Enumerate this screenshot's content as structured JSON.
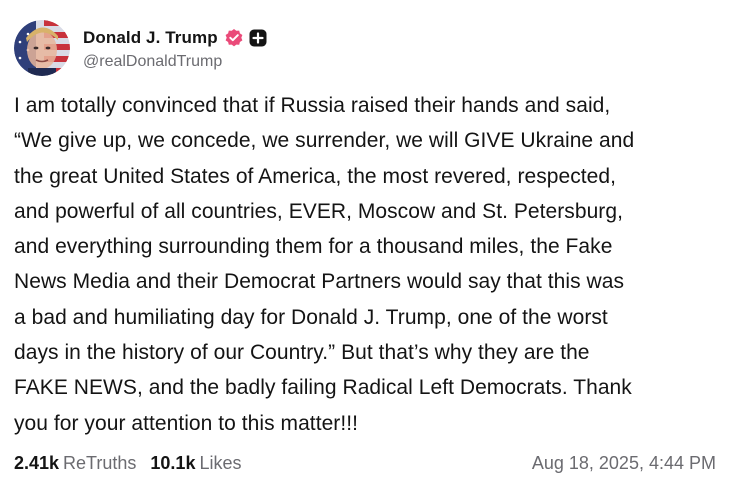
{
  "author": {
    "display_name": "Donald J. Trump",
    "handle": "@realDonaldTrump",
    "avatar_icon": "profile-avatar",
    "verified_icon": "verified-badge-icon",
    "subscribe_icon": "plus-icon",
    "verified_color": "#ea4a79"
  },
  "post": {
    "text": "I am totally convinced that if Russia raised their hands and said,\n“We give up, we concede, we surrender, we will GIVE Ukraine and\nthe great United States of America, the most revered, respected,\nand powerful of all countries, EVER, Moscow and St. Petersburg,\nand everything surrounding them for a thousand miles, the Fake\nNews Media and their Democrat Partners would say that this was\na bad and humiliating day for Donald J. Trump, one of the worst\ndays in the history of our Country.” But that’s why they are the\nFAKE NEWS, and the badly failing Radical Left Democrats. Thank\nyou for your attention to this matter!!!"
  },
  "stats": {
    "retruths_count": "2.41k",
    "retruths_label": "ReTruths",
    "likes_count": "10.1k",
    "likes_label": "Likes"
  },
  "timestamp": "Aug 18, 2025, 4:44 PM"
}
